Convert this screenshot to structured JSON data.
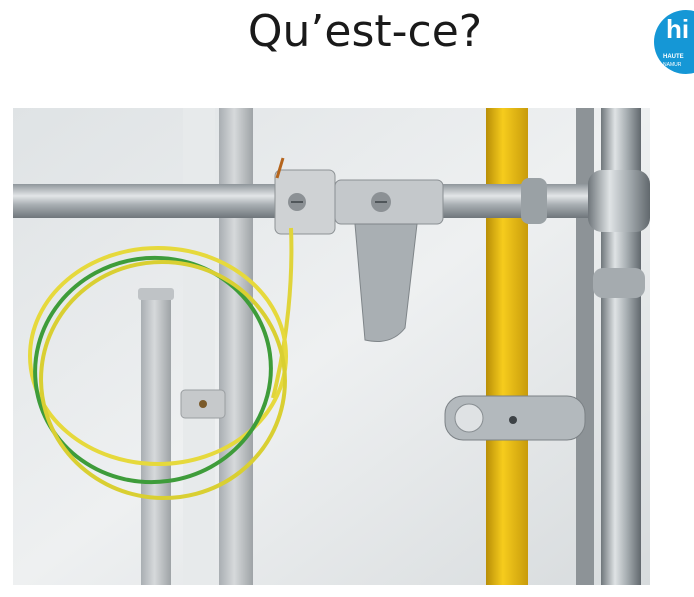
{
  "slide": {
    "title": "Qu’est-ce?"
  },
  "logo": {
    "letters": "hi",
    "line1": "HAUTE",
    "line2": "NAMUR",
    "color": "#1597d6"
  },
  "photo": {
    "colors": {
      "wall": "#e6e9ea",
      "gas_pipe": "#f0c419",
      "metal": "#b9bec2",
      "earth_wire_green": "#3aa83a",
      "earth_wire_yellow": "#e8d93a"
    }
  }
}
